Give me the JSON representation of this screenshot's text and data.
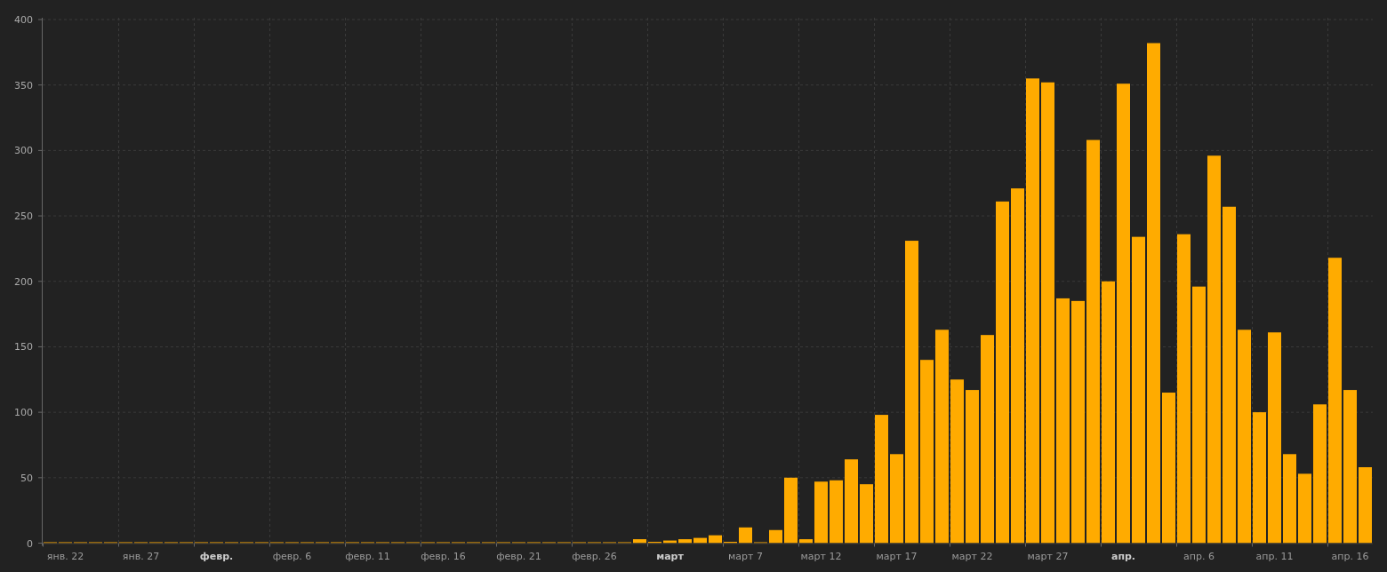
{
  "chart": {
    "chart_data": {
      "type": "bar",
      "grid": true,
      "categories": [
        null,
        "янв. 22",
        null,
        null,
        null,
        null,
        "янв. 27",
        null,
        null,
        null,
        null,
        "февр.",
        null,
        null,
        null,
        null,
        "февр. 6",
        null,
        null,
        null,
        null,
        "февр. 11",
        null,
        null,
        null,
        null,
        "февр. 16",
        null,
        null,
        null,
        null,
        "февр. 21",
        null,
        null,
        null,
        null,
        "февр. 26",
        null,
        null,
        null,
        null,
        "март",
        null,
        null,
        null,
        null,
        "март 7",
        null,
        null,
        null,
        null,
        "март 12",
        null,
        null,
        null,
        null,
        "март 17",
        null,
        null,
        null,
        null,
        "март 22",
        null,
        null,
        null,
        null,
        "март 27",
        null,
        null,
        null,
        null,
        "апр.",
        null,
        null,
        null,
        null,
        "апр. 6",
        null,
        null,
        null,
        null,
        "апр. 11",
        null,
        null,
        null,
        null,
        "апр. 16",
        null
      ],
      "values": [
        0,
        0,
        0,
        0,
        0,
        0,
        0,
        0,
        0,
        0,
        0,
        0,
        0,
        0,
        0,
        0,
        0,
        0,
        0,
        0,
        0,
        0,
        0,
        0,
        0,
        0,
        0,
        0,
        0,
        0,
        0,
        0,
        0,
        0,
        0,
        0,
        0,
        0,
        0,
        3,
        1,
        2,
        3,
        4,
        6,
        1,
        12,
        0,
        10,
        50,
        3,
        47,
        48,
        64,
        45,
        98,
        68,
        231,
        140,
        163,
        125,
        117,
        159,
        261,
        271,
        355,
        352,
        187,
        185,
        308,
        200,
        351,
        234,
        382,
        115,
        236,
        196,
        296,
        257,
        163,
        100,
        161,
        68,
        53,
        106,
        218,
        117,
        58
      ],
      "ylim": [
        0,
        400
      ],
      "yticks": [
        0,
        50,
        100,
        150,
        200,
        250,
        300,
        350,
        400
      ]
    }
  }
}
